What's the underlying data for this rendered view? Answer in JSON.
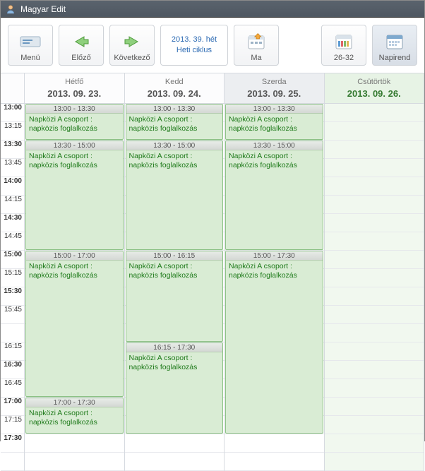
{
  "window": {
    "title": "Magyar Edit"
  },
  "toolbar": {
    "menu": "Menü",
    "prev": "Előző",
    "next": "Következő",
    "week_top": "2013. 39. hét",
    "week_bottom": "Heti ciklus",
    "today": "Ma",
    "weeks": "26-32",
    "agenda": "Napirend"
  },
  "days": [
    {
      "name": "Hétfő",
      "date": "2013. 09. 23.",
      "state": ""
    },
    {
      "name": "Kedd",
      "date": "2013. 09. 24.",
      "state": ""
    },
    {
      "name": "Szerda",
      "date": "2013. 09. 25.",
      "state": "current"
    },
    {
      "name": "Csütörtök",
      "date": "2013. 09. 26.",
      "state": "today"
    }
  ],
  "timeStartHour": 13,
  "timeSlotMinutes": 15,
  "timeSlotCount": 20,
  "timeSlotHeight": 26,
  "timeLabels": [
    "13:00",
    "13:15",
    "13:30",
    "13:45",
    "14:00",
    "14:15",
    "14:30",
    "14:45",
    "15:00",
    "15:15",
    "15:30",
    "15:45",
    "16:15",
    "16:30",
    "16:45",
    "17:00",
    "17:15",
    "17:30"
  ],
  "eventTitle": "Napközi A csoport : napközis foglalkozás",
  "events": [
    {
      "day": 0,
      "start": "13:00",
      "end": "13:30"
    },
    {
      "day": 0,
      "start": "13:30",
      "end": "15:00"
    },
    {
      "day": 0,
      "start": "15:00",
      "end": "17:00"
    },
    {
      "day": 0,
      "start": "17:00",
      "end": "17:30"
    },
    {
      "day": 1,
      "start": "13:00",
      "end": "13:30"
    },
    {
      "day": 1,
      "start": "13:30",
      "end": "15:00"
    },
    {
      "day": 1,
      "start": "15:00",
      "end": "16:15"
    },
    {
      "day": 1,
      "start": "16:15",
      "end": "17:30"
    },
    {
      "day": 2,
      "start": "13:00",
      "end": "13:30"
    },
    {
      "day": 2,
      "start": "13:30",
      "end": "15:00"
    },
    {
      "day": 2,
      "start": "15:00",
      "end": "17:30"
    }
  ]
}
